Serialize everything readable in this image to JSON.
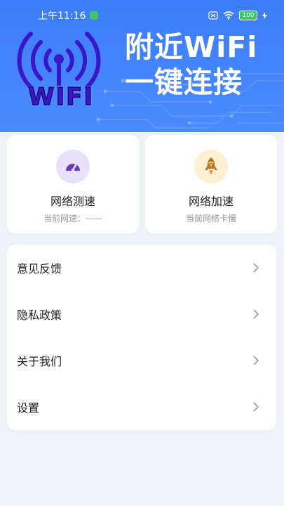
{
  "status_bar": {
    "time": "上午11:16",
    "battery": "100"
  },
  "banner": {
    "logo_text": "WIFI",
    "title_line1": "附近WiFi",
    "title_line2": "一键连接"
  },
  "tools": [
    {
      "title": "网络测速",
      "subtitle": "当前网速：——",
      "icon": "speedometer-icon",
      "icon_bg": "#e7e1fb",
      "icon_color": "#6a3ab8"
    },
    {
      "title": "网络加速",
      "subtitle": "当前网络卡慢",
      "icon": "rocket-icon",
      "icon_bg": "#fdf0d2",
      "icon_color": "#b5741c"
    }
  ],
  "menu": [
    {
      "label": "意见反馈"
    },
    {
      "label": "隐私政策"
    },
    {
      "label": "关于我们"
    },
    {
      "label": "设置"
    }
  ],
  "colors": {
    "banner": "#4385fb",
    "background": "#eef1f8",
    "card": "#ffffff"
  }
}
